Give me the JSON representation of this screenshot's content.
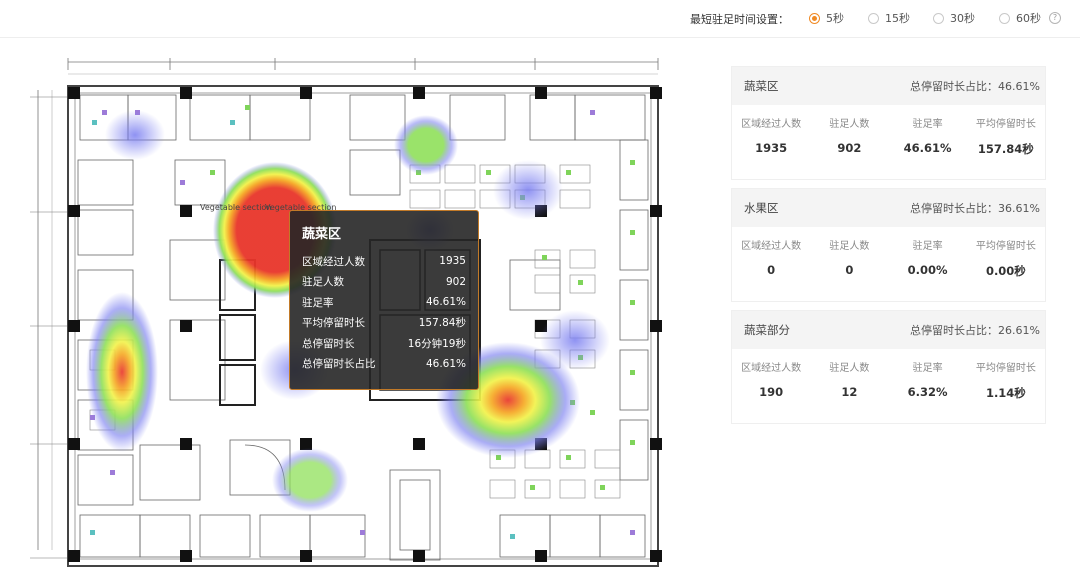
{
  "settings": {
    "label": "最短驻足时间设置：",
    "options": [
      {
        "label": "5秒",
        "selected": true
      },
      {
        "label": "15秒",
        "selected": false
      },
      {
        "label": "30秒",
        "selected": false
      },
      {
        "label": "60秒",
        "selected": false
      }
    ],
    "help_icon": "question-circle-icon",
    "accent_color": "#f08a24"
  },
  "map": {
    "overlay_text": "Vegetable section",
    "heat_colors": [
      "#e8352a",
      "#f5a623",
      "#f2f24a",
      "#8fe05a",
      "#7b7ff0"
    ]
  },
  "tooltip": {
    "title": "蔬菜区",
    "rows": [
      {
        "label": "区域经过人数",
        "value": "1935"
      },
      {
        "label": "驻足人数",
        "value": "902"
      },
      {
        "label": "驻足率",
        "value": "46.61%"
      },
      {
        "label": "平均停留时长",
        "value": "157.84秒"
      },
      {
        "label": "总停留时长",
        "value": "16分钟19秒"
      },
      {
        "label": "总停留时长占比",
        "value": "46.61%"
      }
    ]
  },
  "zones": [
    {
      "name": "蔬菜区",
      "ratio": "总停留时长占比：46.61%",
      "stats": [
        {
          "label": "区域经过人数",
          "value": "1935"
        },
        {
          "label": "驻足人数",
          "value": "902"
        },
        {
          "label": "驻足率",
          "value": "46.61%"
        },
        {
          "label": "平均停留时长",
          "value": "157.84秒"
        }
      ]
    },
    {
      "name": "水果区",
      "ratio": "总停留时长占比：36.61%",
      "stats": [
        {
          "label": "区域经过人数",
          "value": "0"
        },
        {
          "label": "驻足人数",
          "value": "0"
        },
        {
          "label": "驻足率",
          "value": "0.00%"
        },
        {
          "label": "平均停留时长",
          "value": "0.00秒"
        }
      ]
    },
    {
      "name": "蔬菜部分",
      "ratio": "总停留时长占比：26.61%",
      "stats": [
        {
          "label": "区域经过人数",
          "value": "190"
        },
        {
          "label": "驻足人数",
          "value": "12"
        },
        {
          "label": "驻足率",
          "value": "6.32%"
        },
        {
          "label": "平均停留时长",
          "value": "1.14秒"
        }
      ]
    }
  ]
}
